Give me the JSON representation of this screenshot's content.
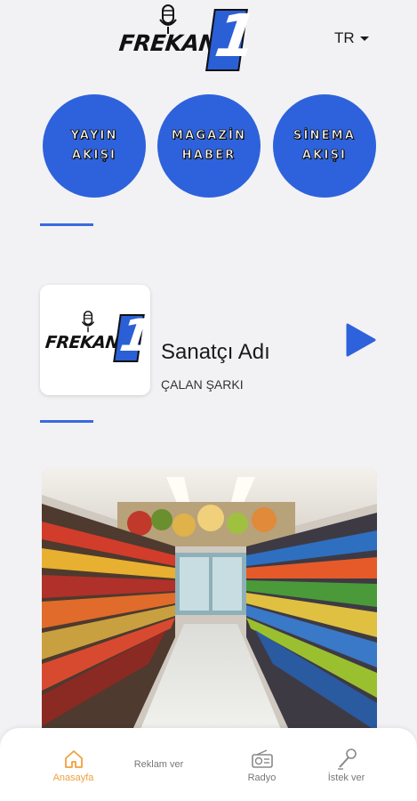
{
  "header": {
    "logo_text": "FREKANS",
    "logo_number": "1",
    "language": "TR"
  },
  "quick_links": [
    {
      "line1": "YAYIN",
      "line2": "AKIŞI"
    },
    {
      "line1": "MAGAZİN",
      "line2": "HABER"
    },
    {
      "line1": "SİNEMA",
      "line2": "AKIŞI"
    }
  ],
  "now_playing": {
    "artist": "Sanatçı Adı",
    "song": "ÇALAN ŞARKI"
  },
  "bottom_nav": {
    "items": [
      {
        "label": "Anasayfa"
      },
      {
        "label": "Reklam ver"
      },
      {
        "label": "Radyo"
      },
      {
        "label": "İstek ver"
      }
    ]
  },
  "colors": {
    "accent": "#2e62dc",
    "active_tab": "#f0a040",
    "background": "#f2f2f4"
  }
}
